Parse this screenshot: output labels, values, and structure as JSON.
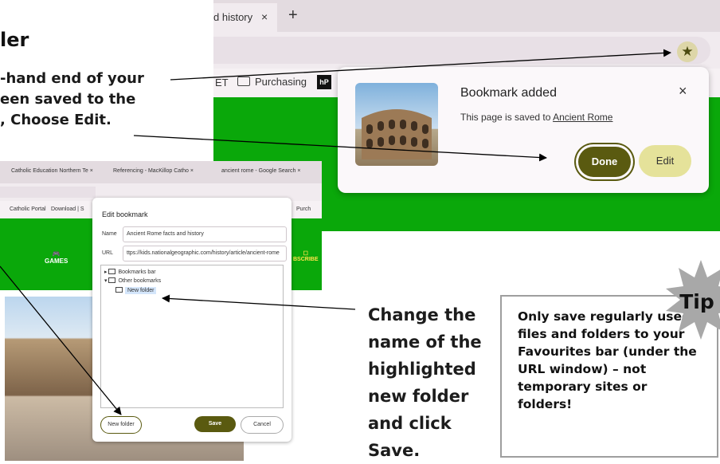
{
  "left_text": {
    "heading": "ler",
    "lines": [
      "-hand end of your",
      "een saved to the",
      ", Choose "
    ],
    "edit_word": "Edit."
  },
  "browser": {
    "tab_title": "d history",
    "tab_close": "×",
    "new_tab": "+",
    "star_icon": "★",
    "bookmarks": {
      "et": "ET",
      "purchasing": "Purchasing",
      "hp": "hP"
    }
  },
  "popup": {
    "title": "Bookmark added",
    "text": "This page is saved to ",
    "folder": "Ancient Rome",
    "close": "×",
    "done": "Done",
    "edit": "Edit"
  },
  "shot2": {
    "tabs": [
      "Catholic Education Northern Te ×",
      "Referencing - MacKillop Catho ×",
      "ancient rome - Google Search ×"
    ],
    "bookmarks": [
      "Catholic Portal",
      "Download | S"
    ],
    "bookmarks_right": "Purch",
    "games": "GAMES",
    "subscribe": "BSCRIBE"
  },
  "dialog": {
    "title": "Edit bookmark",
    "name_label": "Name",
    "name_value": "Ancient Rome facts and history",
    "url_label": "URL",
    "url_value": "ttps://kids.nationalgeographic.com/history/article/ancient-rome",
    "tree": {
      "bookmarks_bar": "Bookmarks bar",
      "other_bookmarks": "Other bookmarks",
      "new_folder": "New folder"
    },
    "new_folder_btn": "New folder",
    "save_btn": "Save",
    "cancel_btn": "Cancel"
  },
  "right_instruction": {
    "change": "Change",
    "rest_line1": " the",
    "line2": "name of the",
    "line3": "highlighted",
    "line4": "new folder",
    "line5": "and click",
    "save": "Save."
  },
  "tip": {
    "label": "Tip",
    "text": "Only save regularly used files and folders to your Favourites bar (under the URL window) – not temporary sites or folders!"
  },
  "colors": {
    "green": "#0aa80a",
    "olive": "#5a5a10",
    "edit_yellow": "#e5e29a",
    "chrome_bg": "#e3dbe0"
  }
}
